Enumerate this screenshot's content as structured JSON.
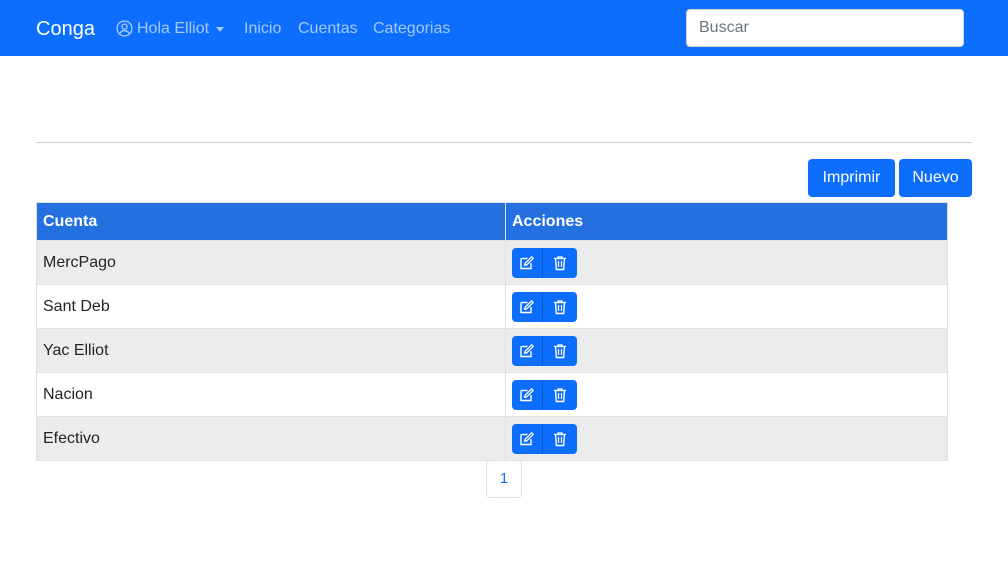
{
  "navbar": {
    "brand": "Conga",
    "user_menu": "Hola Elliot",
    "links": [
      "Inicio",
      "Cuentas",
      "Categorias"
    ],
    "search_placeholder": "Buscar"
  },
  "toolbar": {
    "print_label": "Imprimir",
    "new_label": "Nuevo"
  },
  "table": {
    "headers": [
      "Cuenta",
      "Acciones"
    ],
    "rows": [
      "MercPago",
      "Sant Deb",
      "Yac Elliot",
      "Nacion",
      "Efectivo"
    ]
  },
  "pagination": {
    "current_page": "1"
  },
  "colors": {
    "primary": "#0d6efd",
    "header": "#2470e0",
    "row_stripe": "#ececec"
  }
}
